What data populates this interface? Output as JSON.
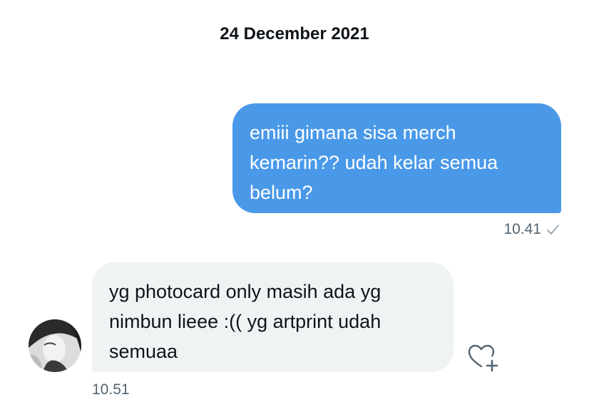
{
  "conversation": {
    "date_header": "24 December 2021",
    "messages": [
      {
        "direction": "outgoing",
        "text": "emiii gimana sisa merch kemarin?? udah kelar semua belum?",
        "time": "10.41",
        "status_icon": "check-icon"
      },
      {
        "direction": "incoming",
        "text": "yg photocard only masih ada yg nimbun lieee :(( yg artprint udah semuaa",
        "time": "10.51",
        "avatar_icon": "avatar-image",
        "reaction_icon": "heart-add-icon"
      }
    ]
  },
  "colors": {
    "outgoing_bubble": "#4a99e9",
    "incoming_bubble": "#eff3f4",
    "meta_text": "#536471"
  }
}
